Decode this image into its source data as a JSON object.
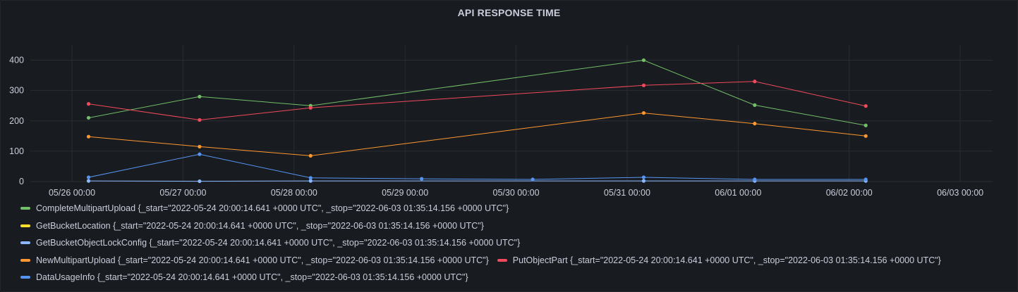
{
  "panel": {
    "title": "API RESPONSE TIME"
  },
  "chart_data": {
    "type": "line",
    "title": "API RESPONSE TIME",
    "xlabel": "",
    "ylabel": "",
    "x_ticks": [
      "05/26 00:00",
      "05/27 00:00",
      "05/28 00:00",
      "05/29 00:00",
      "05/30 00:00",
      "05/31 00:00",
      "06/01 00:00",
      "06/02 00:00",
      "06/03 00:00"
    ],
    "y_ticks": [
      "0",
      "100",
      "200",
      "300",
      "400"
    ],
    "xlim": [
      "2022-05-25T15:00",
      "2022-06-03T07:00"
    ],
    "ylim": [
      0,
      450
    ],
    "grid": true,
    "legend_position": "bottom",
    "x": [
      "2022-05-26T03:35",
      "2022-05-27T03:35",
      "2022-05-28T03:35",
      "2022-05-31T03:35",
      "2022-06-01T03:35",
      "2022-06-02T03:35"
    ],
    "series": [
      {
        "name": "CompleteMultipartUpload {_start=\"2022-05-24 20:00:14.641 +0000 UTC\", _stop=\"2022-06-03 01:35:14.156 +0000 UTC\"}",
        "color": "#73bf69",
        "points": [
          [
            "2022-05-26T03:35",
            210
          ],
          [
            "2022-05-27T03:35",
            280
          ],
          [
            "2022-05-28T03:35",
            250
          ],
          [
            "2022-05-31T03:35",
            400
          ],
          [
            "2022-06-01T03:35",
            252
          ],
          [
            "2022-06-02T03:35",
            185
          ]
        ]
      },
      {
        "name": "GetBucketLocation {_start=\"2022-05-24 20:00:14.641 +0000 UTC\", _stop=\"2022-06-03 01:35:14.156 +0000 UTC\"}",
        "color": "#fade2a",
        "points": []
      },
      {
        "name": "GetBucketObjectLockConfig {_start=\"2022-05-24 20:00:14.641 +0000 UTC\", _stop=\"2022-06-03 01:35:14.156 +0000 UTC\"}",
        "color": "#8ab8ff",
        "points": [
          [
            "2022-05-26T03:35",
            2
          ],
          [
            "2022-05-27T03:35",
            1
          ],
          [
            "2022-05-28T03:35",
            2
          ],
          [
            "2022-05-31T03:35",
            2
          ],
          [
            "2022-06-01T03:35",
            2
          ],
          [
            "2022-06-02T03:35",
            2
          ]
        ]
      },
      {
        "name": "NewMultipartUpload {_start=\"2022-05-24 20:00:14.641 +0000 UTC\", _stop=\"2022-06-03 01:35:14.156 +0000 UTC\"}",
        "color": "#ff9830",
        "points": [
          [
            "2022-05-26T03:35",
            148
          ],
          [
            "2022-05-27T03:35",
            115
          ],
          [
            "2022-05-28T03:35",
            85
          ],
          [
            "2022-05-31T03:35",
            226
          ],
          [
            "2022-06-01T03:35",
            191
          ],
          [
            "2022-06-02T03:35",
            150
          ]
        ]
      },
      {
        "name": "PutObjectPart {_start=\"2022-05-24 20:00:14.641 +0000 UTC\", _stop=\"2022-06-03 01:35:14.156 +0000 UTC\"}",
        "color": "#f2495c",
        "points": [
          [
            "2022-05-26T03:35",
            256
          ],
          [
            "2022-05-27T03:35",
            203
          ],
          [
            "2022-05-28T03:35",
            243
          ],
          [
            "2022-05-31T03:35",
            317
          ],
          [
            "2022-06-01T03:35",
            330
          ],
          [
            "2022-06-02T03:35",
            249
          ]
        ]
      },
      {
        "name": "DataUsageInfo {_start=\"2022-05-24 20:00:14.641 +0000 UTC\", _stop=\"2022-06-03 01:35:14.156 +0000 UTC\"}",
        "color": "#5794f2",
        "points": [
          [
            "2022-05-26T03:35",
            14
          ],
          [
            "2022-05-27T03:35",
            90
          ],
          [
            "2022-05-28T03:35",
            12
          ],
          [
            "2022-05-29T03:35",
            9
          ],
          [
            "2022-05-30T03:35",
            7
          ],
          [
            "2022-05-31T03:35",
            14
          ],
          [
            "2022-06-01T03:35",
            7
          ],
          [
            "2022-06-02T03:35",
            7
          ]
        ]
      }
    ]
  },
  "legend": {
    "rows": [
      [
        0
      ],
      [
        1
      ],
      [
        2
      ],
      [
        3,
        4
      ],
      [
        5
      ]
    ]
  }
}
